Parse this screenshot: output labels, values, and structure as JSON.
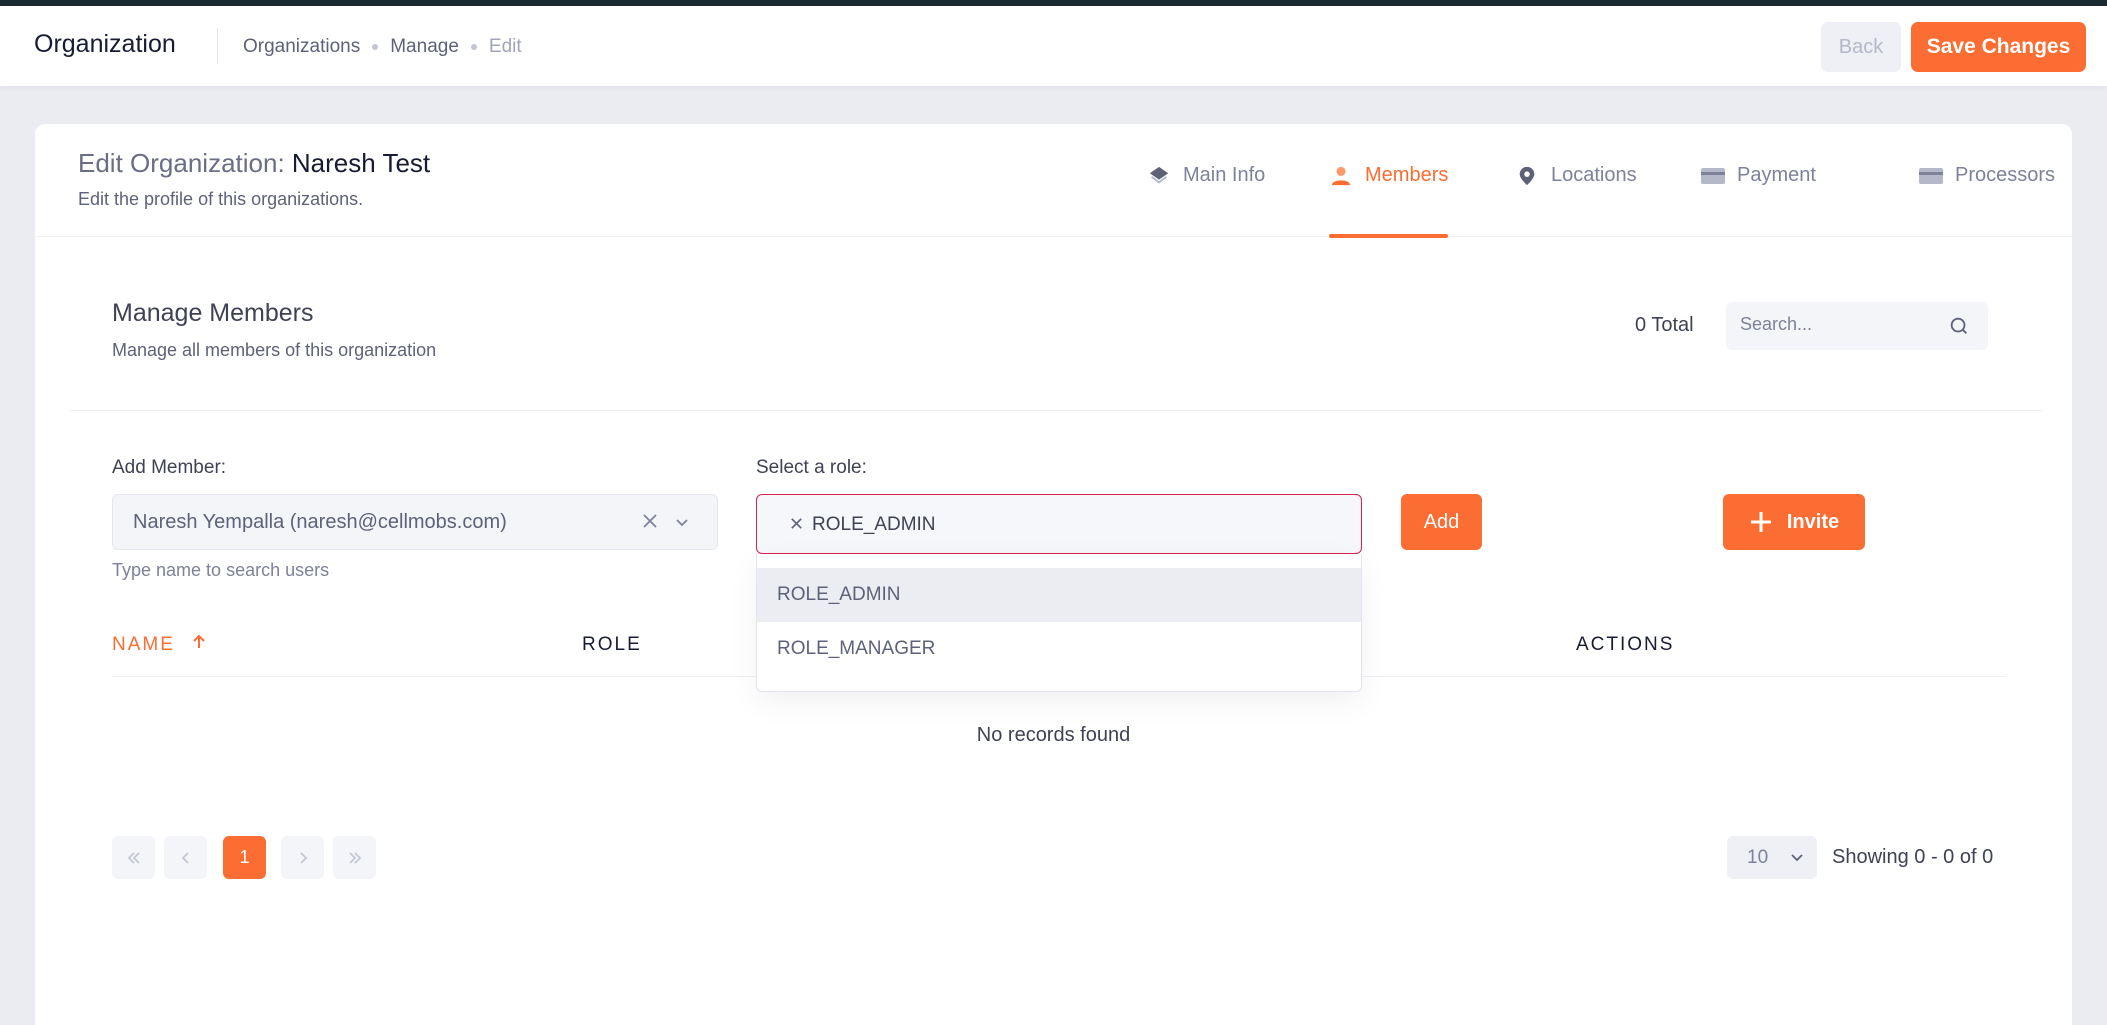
{
  "header": {
    "title": "Organization",
    "breadcrumbs": [
      "Organizations",
      "Manage",
      "Edit"
    ],
    "back_label": "Back",
    "save_label": "Save Changes"
  },
  "org": {
    "title_prefix": "Edit Organization:",
    "name": "Naresh Test",
    "subtitle": "Edit the profile of this organizations."
  },
  "tabs": [
    {
      "label": "Main Info",
      "icon": "layers-icon",
      "active": false
    },
    {
      "label": "Members",
      "icon": "user-icon",
      "active": true
    },
    {
      "label": "Locations",
      "icon": "map-pin-icon",
      "active": false
    },
    {
      "label": "Payment",
      "icon": "credit-card-icon",
      "active": false
    },
    {
      "label": "Processors",
      "icon": "credit-card-icon",
      "active": false
    }
  ],
  "members": {
    "title": "Manage Members",
    "subtitle": "Manage all members of this organization",
    "total": "0 Total",
    "search_placeholder": "Search..."
  },
  "form": {
    "add_member_label": "Add Member:",
    "member_value": "Naresh Yempalla (naresh@cellmobs.com)",
    "member_helper": "Type name to search users",
    "role_label": "Select a role:",
    "role_value": "ROLE_ADMIN",
    "role_options": [
      "ROLE_ADMIN",
      "ROLE_MANAGER"
    ],
    "add_label": "Add",
    "invite_label": "Invite"
  },
  "table": {
    "columns": [
      "NAME",
      "ROLE",
      "ACTIONS"
    ],
    "empty_text": "No records found"
  },
  "pagination": {
    "current_page": "1",
    "per_page": "10",
    "showing": "Showing 0 - 0 of 0"
  },
  "colors": {
    "accent": "#fb6d32",
    "error_border": "#d9214e"
  }
}
